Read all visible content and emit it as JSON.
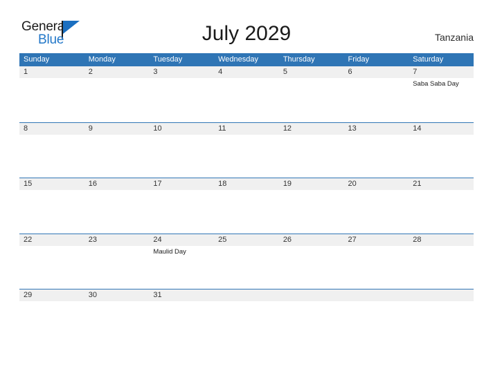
{
  "brand": {
    "name_part1": "General",
    "name_part2": "Blue",
    "flag_icon": "flag-icon",
    "accent_color": "#2277c8"
  },
  "header": {
    "title": "July 2029",
    "country": "Tanzania"
  },
  "theme": {
    "header_blue": "#2f75b5",
    "band_gray": "#f0f0f0",
    "text_dark": "#333333",
    "page_background": "#ffffff"
  },
  "calendar": {
    "weekdays": [
      "Sunday",
      "Monday",
      "Tuesday",
      "Wednesday",
      "Thursday",
      "Friday",
      "Saturday"
    ],
    "weeks": [
      [
        {
          "date": "1",
          "events": []
        },
        {
          "date": "2",
          "events": []
        },
        {
          "date": "3",
          "events": []
        },
        {
          "date": "4",
          "events": []
        },
        {
          "date": "5",
          "events": []
        },
        {
          "date": "6",
          "events": []
        },
        {
          "date": "7",
          "events": [
            "Saba Saba Day"
          ]
        }
      ],
      [
        {
          "date": "8",
          "events": []
        },
        {
          "date": "9",
          "events": []
        },
        {
          "date": "10",
          "events": []
        },
        {
          "date": "11",
          "events": []
        },
        {
          "date": "12",
          "events": []
        },
        {
          "date": "13",
          "events": []
        },
        {
          "date": "14",
          "events": []
        }
      ],
      [
        {
          "date": "15",
          "events": []
        },
        {
          "date": "16",
          "events": []
        },
        {
          "date": "17",
          "events": []
        },
        {
          "date": "18",
          "events": []
        },
        {
          "date": "19",
          "events": []
        },
        {
          "date": "20",
          "events": []
        },
        {
          "date": "21",
          "events": []
        }
      ],
      [
        {
          "date": "22",
          "events": []
        },
        {
          "date": "23",
          "events": []
        },
        {
          "date": "24",
          "events": [
            "Maulid Day"
          ]
        },
        {
          "date": "25",
          "events": []
        },
        {
          "date": "26",
          "events": []
        },
        {
          "date": "27",
          "events": []
        },
        {
          "date": "28",
          "events": []
        }
      ],
      [
        {
          "date": "29",
          "events": []
        },
        {
          "date": "30",
          "events": []
        },
        {
          "date": "31",
          "events": []
        },
        {
          "date": "",
          "events": []
        },
        {
          "date": "",
          "events": []
        },
        {
          "date": "",
          "events": []
        },
        {
          "date": "",
          "events": []
        }
      ]
    ]
  }
}
